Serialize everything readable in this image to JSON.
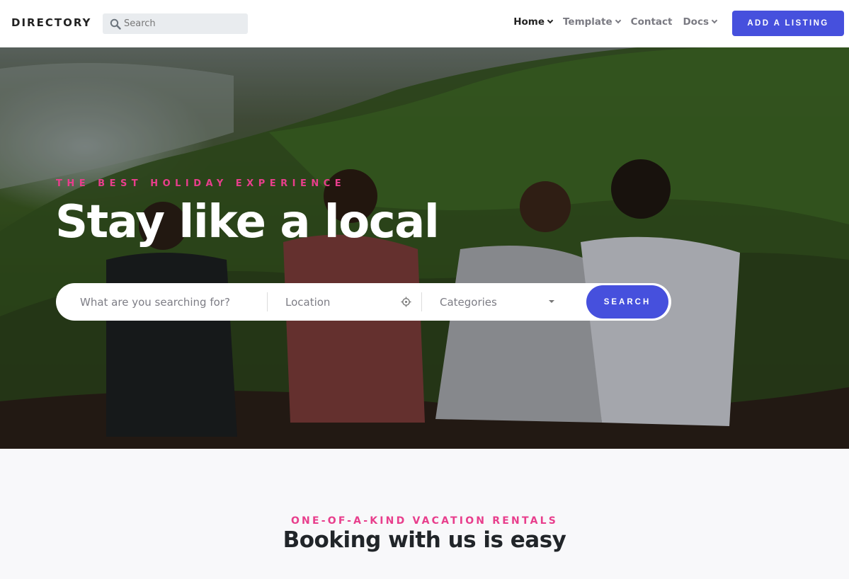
{
  "navbar": {
    "brand": "DIRECTORY",
    "search_placeholder": "Search",
    "links": [
      {
        "label": "Home",
        "active": true,
        "dropdown": true
      },
      {
        "label": "Template",
        "active": false,
        "dropdown": true
      },
      {
        "label": "Contact",
        "active": false,
        "dropdown": false
      },
      {
        "label": "Docs",
        "active": false,
        "dropdown": true
      }
    ],
    "cta_label": "ADD A LISTING"
  },
  "hero": {
    "eyebrow": "THE BEST HOLIDAY EXPERIENCE",
    "title": "Stay like a local",
    "search": {
      "what_placeholder": "What are you searching for?",
      "location_placeholder": "Location",
      "category_placeholder": "Categories",
      "button_label": "SEARCH"
    }
  },
  "section": {
    "eyebrow": "ONE-OF-A-KIND VACATION RENTALS",
    "title": "Booking with us is easy"
  },
  "colors": {
    "primary": "#4650dd",
    "accent_pink": "#e83e8c"
  }
}
